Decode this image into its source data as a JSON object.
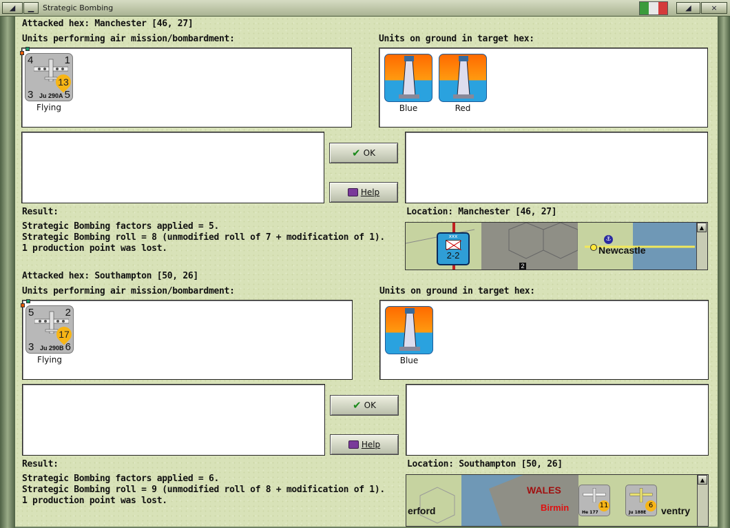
{
  "window": {
    "title": "Strategic Bombing",
    "close": "×"
  },
  "buttons": {
    "ok": "OK",
    "help": "Help"
  },
  "sections": [
    {
      "attacked": "Attacked hex: Manchester  [46, 27]",
      "air_label": "Units performing air mission/bombardment:",
      "ground_label": "Units on ground in target hex:",
      "air_units": [
        {
          "top_left": "4",
          "top_right": "1",
          "bottom_left": "3",
          "bottom_right": "5",
          "name": "Ju 290A",
          "badge": "13",
          "status": "Flying"
        }
      ],
      "ground_units": [
        {
          "label": "Blue"
        },
        {
          "label": "Red"
        }
      ],
      "result_label": "Result:",
      "result_lines": [
        "Strategic Bombing factors applied = 5.",
        "Strategic Bombing roll = 8 (unmodified roll of 7 + modification of 1).",
        "1 production point was lost."
      ],
      "location": "Location:  Manchester  [46, 27]",
      "map": {
        "city": "Newcastle",
        "counter_top": "xxx",
        "counter_value": "2-2",
        "marker": "2"
      }
    },
    {
      "attacked": "Attacked hex: Southampton  [50, 26]",
      "air_label": "Units performing air mission/bombardment:",
      "ground_label": "Units on ground in target hex:",
      "air_units": [
        {
          "top_left": "5",
          "top_right": "2",
          "bottom_left": "3",
          "bottom_right": "6",
          "name": "Ju 290B",
          "badge": "17",
          "status": "Flying"
        }
      ],
      "ground_units": [
        {
          "label": "Blue"
        }
      ],
      "result_label": "Result:",
      "result_lines": [
        "Strategic Bombing factors applied = 6.",
        "Strategic Bombing roll = 9 (unmodified roll of 8 + modification of 1).",
        "1 production point was lost."
      ],
      "location": "Location:  Southampton  [50, 26]",
      "map": {
        "region": "WALES",
        "city_red": "Birmin",
        "city_left": "erford",
        "city_right": "ventry",
        "unit1_badge": "11",
        "unit1_name": "He 177",
        "unit2_badge": "6",
        "unit2_name": "Ju 188E"
      }
    }
  ],
  "colors": {
    "panel": "#d8e2b8",
    "frame": "#6d8060",
    "badge": "#f7b516",
    "sea": "#2aa2df",
    "fire": "#ff6a00"
  }
}
